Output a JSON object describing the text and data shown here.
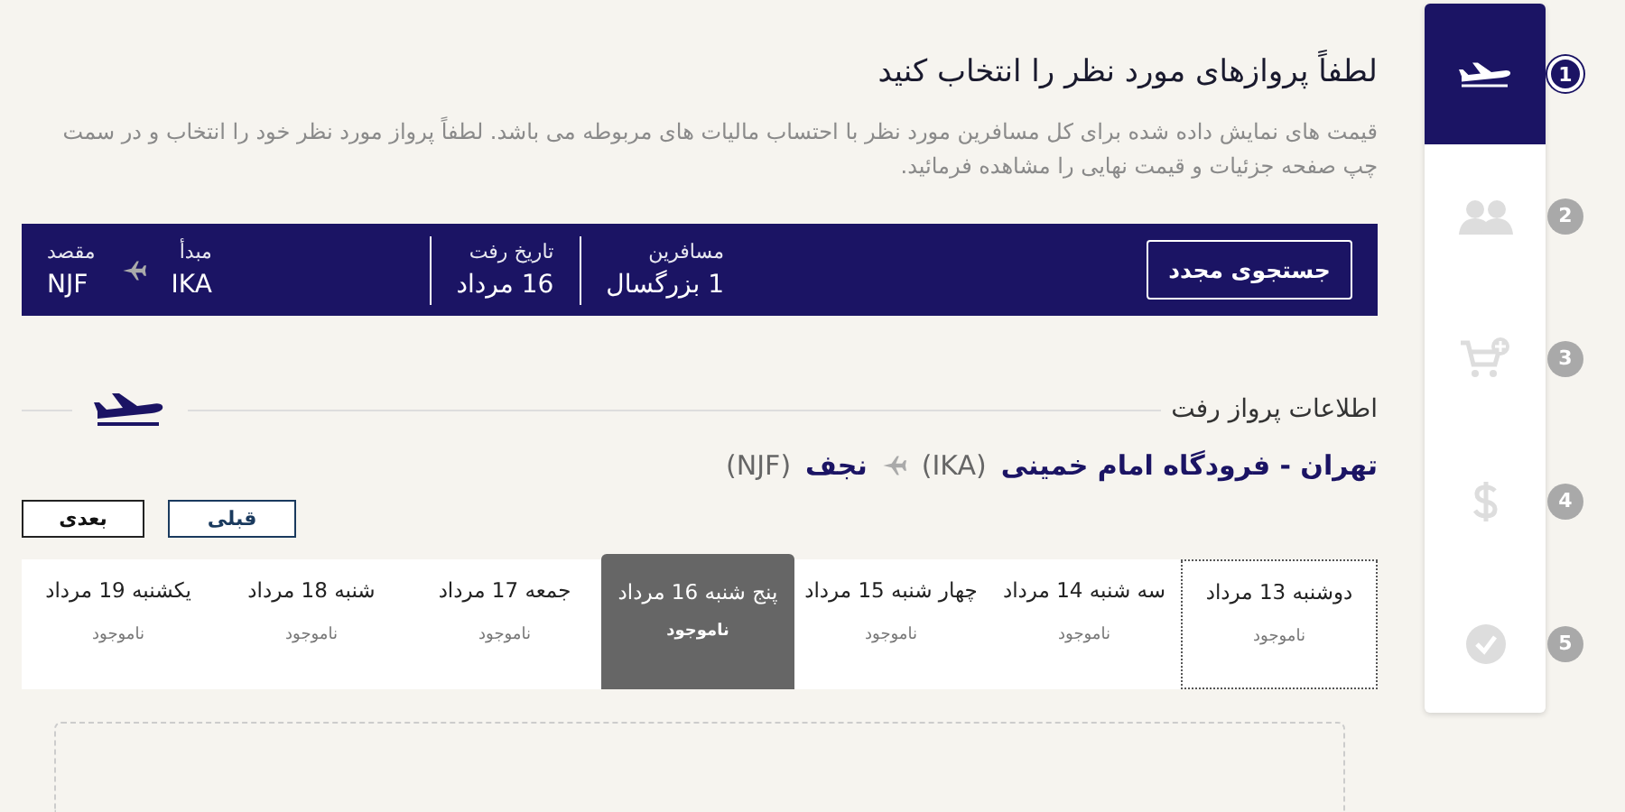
{
  "header": {
    "title": "لطفاً پروازهای مورد نظر را انتخاب کنید",
    "description": "قیمت های نمایش داده شده برای کل مسافرین مورد نظر با احتساب مالیات های مربوطه می باشد. لطفاً پرواز مورد نظر خود را انتخاب و در سمت چپ صفحه جزئیات و قیمت نهایی را مشاهده فرمائید."
  },
  "search_bar": {
    "button": "جستجوی مجدد",
    "fields": [
      {
        "label": "مسافرین",
        "value": "1 بزرگسال"
      },
      {
        "label": "تاریخ رفت",
        "value": "16 مرداد"
      }
    ],
    "origin": {
      "label": "مبدأ",
      "value": "IKA"
    },
    "destination": {
      "label": "مقصد",
      "value": "NJF"
    }
  },
  "section": {
    "title": "اطلاعات پرواز رفت"
  },
  "route": {
    "from": "تهران - فرودگاه امام خمینی",
    "from_code": "(IKA)",
    "to": "نجف",
    "to_code": "(NJF)"
  },
  "nav_buttons": [
    {
      "label": "قبلی",
      "kind": "prev"
    },
    {
      "label": "بعدی",
      "kind": "next"
    }
  ],
  "dates": [
    {
      "label": "دوشنبه 13 مرداد",
      "status": "ناموجود",
      "selected": false
    },
    {
      "label": "سه شنبه 14 مرداد",
      "status": "ناموجود",
      "selected": false
    },
    {
      "label": "چهار شنبه 15 مرداد",
      "status": "ناموجود",
      "selected": false
    },
    {
      "label": "پنج شنبه 16 مرداد",
      "status": "ناموجود",
      "selected": true
    },
    {
      "label": "جمعه 17 مرداد",
      "status": "ناموجود",
      "selected": false
    },
    {
      "label": "شنبه 18 مرداد",
      "status": "ناموجود",
      "selected": false
    },
    {
      "label": "يكشنبه 19 مرداد",
      "status": "ناموجود",
      "selected": false
    }
  ],
  "steps": [
    {
      "number": "1",
      "kind": "flight",
      "selected": true
    },
    {
      "number": "2",
      "kind": "passengers",
      "selected": false
    },
    {
      "number": "3",
      "kind": "extras",
      "selected": false
    },
    {
      "number": "4",
      "kind": "payment",
      "selected": false
    },
    {
      "number": "5",
      "kind": "confirm",
      "selected": false
    }
  ]
}
